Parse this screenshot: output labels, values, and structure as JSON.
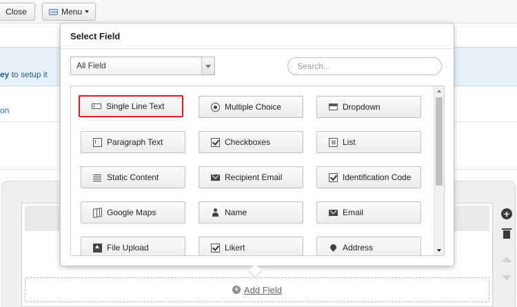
{
  "toolbar": {
    "close_label": "Close",
    "menu_label": "Menu"
  },
  "background": {
    "info_bold": "ey",
    "info_rest": " to setup it",
    "link_fragment": "on"
  },
  "builder": {
    "add_field_label": "Add Field"
  },
  "popup": {
    "title": "Select Field",
    "filter_selected": "All Field",
    "search_placeholder": "Search...",
    "fields": [
      {
        "label": "Single Line Text",
        "icon": "single-line-text-icon",
        "selected": true
      },
      {
        "label": "Multiple Choice",
        "icon": "radio-icon",
        "selected": false
      },
      {
        "label": "Dropdown",
        "icon": "dropdown-icon",
        "selected": false
      },
      {
        "label": "Paragraph Text",
        "icon": "paragraph-icon",
        "selected": false
      },
      {
        "label": "Checkboxes",
        "icon": "checkbox-icon",
        "selected": false
      },
      {
        "label": "List",
        "icon": "list-icon",
        "selected": false
      },
      {
        "label": "Static Content",
        "icon": "lines-icon",
        "selected": false
      },
      {
        "label": "Recipient Email",
        "icon": "mail-icon",
        "selected": false
      },
      {
        "label": "Identification Code",
        "icon": "checkbox-icon",
        "selected": false
      },
      {
        "label": "Google Maps",
        "icon": "map-icon",
        "selected": false
      },
      {
        "label": "Name",
        "icon": "person-icon",
        "selected": false
      },
      {
        "label": "Email",
        "icon": "mail-icon",
        "selected": false
      },
      {
        "label": "File Upload",
        "icon": "upload-icon",
        "selected": false
      },
      {
        "label": "Likert",
        "icon": "checkbox-icon",
        "selected": false
      },
      {
        "label": "Address",
        "icon": "pin-icon",
        "selected": false
      }
    ]
  },
  "colors": {
    "selected_border": "#e31b1b",
    "info_band": "#e6f1fa",
    "link": "#2a6aa8"
  }
}
